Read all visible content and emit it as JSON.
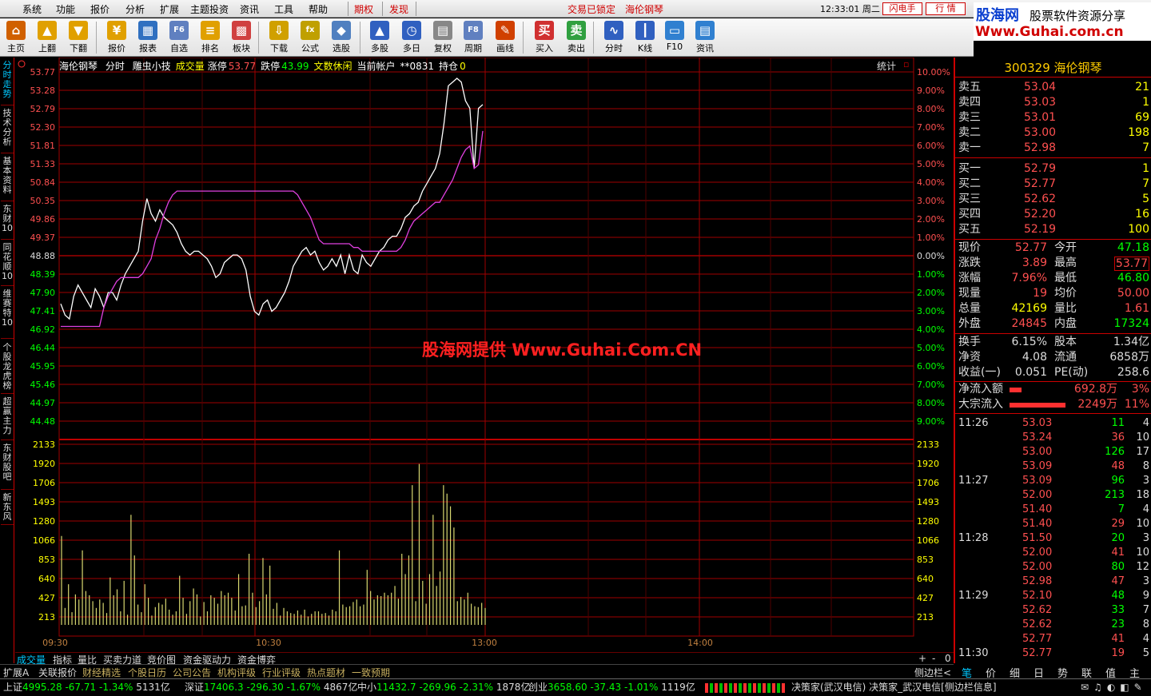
{
  "menu": {
    "items": [
      "系统",
      "功能",
      "报价",
      "分析",
      "扩展",
      "主题投资",
      "资讯",
      "工具",
      "帮助"
    ],
    "qiquan": "期权",
    "faxian": "发现",
    "center_status": "交易已锁定",
    "center_stock": "海伦钢琴",
    "clock": "12:33:01 周二",
    "btn_flash": "闪电手",
    "btn_quote": "行  情"
  },
  "logo": {
    "cn": "股海网",
    "slogan": "股票软件资源分享",
    "url": "Www.Guhai.com.cn"
  },
  "toolbar": [
    {
      "label": "主页",
      "icon": "home-icon",
      "color": "#d06000",
      "glyph": "⌂"
    },
    {
      "label": "上翻",
      "icon": "arrow-up-icon",
      "color": "#e0a000",
      "glyph": "▲"
    },
    {
      "label": "下翻",
      "icon": "arrow-down-icon",
      "color": "#e0a000",
      "glyph": "▼"
    },
    {
      "label": "报价",
      "icon": "yuan-icon",
      "color": "#e0a000",
      "glyph": "¥"
    },
    {
      "label": "报表",
      "icon": "report-icon",
      "color": "#3070c0",
      "glyph": "▦"
    },
    {
      "label": "自选",
      "icon": "f6-icon",
      "color": "#6080c0",
      "glyph": "F6"
    },
    {
      "label": "排名",
      "icon": "rank-icon",
      "color": "#e0a000",
      "glyph": "≡"
    },
    {
      "label": "板块",
      "icon": "sector-icon",
      "color": "#d04040",
      "glyph": "▩"
    },
    {
      "label": "下载",
      "icon": "download-icon",
      "color": "#d0a000",
      "glyph": "⇩"
    },
    {
      "label": "公式",
      "icon": "formula-icon",
      "color": "#c0a000",
      "glyph": "fx"
    },
    {
      "label": "选股",
      "icon": "pick-stock-icon",
      "color": "#5080c0",
      "glyph": "◆"
    },
    {
      "label": "多股",
      "icon": "multi-stock-icon",
      "color": "#3060c0",
      "glyph": "▲"
    },
    {
      "label": "多日",
      "icon": "multi-day-icon",
      "color": "#3060c0",
      "glyph": "◷"
    },
    {
      "label": "复权",
      "icon": "restore-right-icon",
      "color": "#888888",
      "glyph": "▤"
    },
    {
      "label": "周期",
      "icon": "f8-icon",
      "color": "#6080c0",
      "glyph": "F8"
    },
    {
      "label": "画线",
      "icon": "draw-line-icon",
      "color": "#d04000",
      "glyph": "✎"
    },
    {
      "label": "买入",
      "icon": "buy-icon",
      "color": "#d03030",
      "glyph": "买"
    },
    {
      "label": "卖出",
      "icon": "sell-icon",
      "color": "#30a040",
      "glyph": "卖"
    },
    {
      "label": "分时",
      "icon": "intraday-icon",
      "color": "#3060c0",
      "glyph": "∿"
    },
    {
      "label": "K线",
      "icon": "kline-icon",
      "color": "#3060c0",
      "glyph": "┃"
    },
    {
      "label": "F10",
      "icon": "f10-icon",
      "color": "#3080d0",
      "glyph": "▭"
    },
    {
      "label": "资讯",
      "icon": "news-icon",
      "color": "#3080d0",
      "glyph": "▤"
    }
  ],
  "side_tabs": [
    "分时走势",
    "技术分析",
    "基本资料",
    "东财10",
    "同花顺10",
    "维赛特10",
    "个股龙虎榜",
    "超赢主力",
    "东财股吧",
    "新东风"
  ],
  "chart_header": {
    "name": "海伦钢琴",
    "mode": "分时",
    "tool": "雕虫小技",
    "vol_label": "成交量",
    "limit_up_label": "涨停",
    "limit_up": "53.77",
    "limit_down_label": "跌停",
    "limit_down": "43.99",
    "event": "文数休闲",
    "account": "当前帐户",
    "account_no": "**0831",
    "position_label": "持仓",
    "position": "0",
    "stats": "统计",
    "watermark": "股海网提供 Www.Guhai.Com.CN"
  },
  "chart_data": {
    "type": "line",
    "prev_close": 48.88,
    "price_ticks": [
      "53.77",
      "53.28",
      "52.79",
      "52.30",
      "51.81",
      "51.33",
      "50.84",
      "50.35",
      "49.86",
      "49.37",
      "48.88",
      "48.39",
      "47.90",
      "47.41",
      "46.92",
      "46.44",
      "45.95",
      "45.46",
      "44.97",
      "44.48"
    ],
    "pct_ticks": [
      "10.00%",
      "9.00%",
      "8.00%",
      "7.00%",
      "6.00%",
      "5.00%",
      "4.00%",
      "3.00%",
      "2.00%",
      "1.00%",
      "0.00%",
      "1.00%",
      "2.00%",
      "3.00%",
      "4.00%",
      "5.00%",
      "6.00%",
      "7.00%",
      "8.00%",
      "9.00%"
    ],
    "vol_ticks": [
      "2133",
      "1920",
      "1706",
      "1493",
      "1280",
      "1066",
      "853",
      "640",
      "427",
      "213"
    ],
    "time_ticks": [
      "09:30",
      "10:30",
      "13:00",
      "14:00"
    ],
    "series": [
      {
        "color": "#ffffff",
        "values": [
          47.6,
          47.3,
          47.2,
          47.8,
          48.1,
          47.9,
          47.7,
          47.5,
          48.0,
          47.8,
          47.5,
          47.9,
          47.9,
          47.7,
          48.1,
          48.4,
          48.6,
          48.8,
          49.0,
          49.8,
          50.4,
          50.0,
          49.8,
          50.1,
          49.9,
          49.8,
          49.7,
          49.5,
          49.2,
          49.0,
          48.9,
          49.0,
          49.0,
          48.9,
          48.8,
          48.6,
          48.3,
          48.4,
          48.7,
          48.8,
          48.9,
          48.9,
          48.8,
          48.5,
          47.8,
          47.4,
          47.3,
          47.6,
          47.7,
          47.4,
          47.5,
          47.7,
          47.9,
          48.2,
          48.6,
          48.8,
          49.0,
          49.1,
          48.9,
          49.0,
          48.7,
          48.5,
          48.6,
          48.8,
          48.6,
          48.9,
          48.4,
          48.9,
          48.5,
          48.4,
          48.9,
          48.7,
          48.6,
          48.8,
          49.0,
          49.1,
          49.3,
          49.4,
          49.4,
          49.6,
          49.9,
          50.0,
          50.2,
          50.3,
          50.6,
          50.8,
          51.0,
          51.2,
          51.6,
          52.4,
          53.4,
          53.5,
          53.6,
          53.5,
          53.0,
          52.8,
          51.2,
          52.8,
          52.9
        ]
      },
      {
        "color": "#e040e0",
        "values": [
          47.0,
          47.0,
          47.0,
          47.0,
          47.0,
          47.0,
          47.0,
          47.0,
          47.0,
          47.0,
          47.5,
          47.8,
          48.0,
          48.2,
          48.3,
          48.3,
          48.3,
          48.3,
          48.3,
          48.4,
          48.6,
          48.8,
          49.3,
          49.6,
          50.0,
          50.3,
          50.5,
          50.6,
          50.6,
          50.6,
          50.6,
          50.6,
          50.6,
          50.6,
          50.6,
          50.6,
          50.6,
          50.6,
          50.6,
          50.6,
          50.6,
          50.6,
          50.6,
          50.6,
          50.6,
          50.6,
          50.6,
          50.6,
          50.6,
          50.6,
          50.6,
          50.6,
          50.6,
          50.6,
          50.6,
          50.5,
          50.3,
          50.1,
          49.9,
          49.6,
          49.3,
          49.2,
          49.2,
          49.2,
          49.2,
          49.2,
          49.2,
          49.2,
          49.1,
          49.1,
          49.0,
          49.0,
          49.0,
          49.0,
          49.0,
          49.0,
          49.0,
          49.0,
          49.0,
          49.1,
          49.3,
          49.6,
          49.8,
          49.9,
          50.0,
          50.1,
          50.2,
          50.3,
          50.3,
          50.5,
          50.7,
          50.9,
          51.2,
          51.5,
          51.7,
          51.8,
          51.2,
          51.3,
          52.2
        ]
      }
    ],
    "volumes": [
      1050,
      200,
      480,
      150,
      360,
      300,
      880,
      400,
      350,
      280,
      200,
      300,
      260,
      140,
      560,
      350,
      420,
      160,
      520,
      120,
      1300,
      820,
      240,
      150,
      480,
      320,
      110,
      210,
      260,
      240,
      310,
      180,
      120,
      160,
      580,
      320,
      130,
      280,
      430,
      360,
      100,
      270,
      160,
      350,
      320,
      250,
      400,
      350,
      380,
      320,
      170,
      600,
      220,
      230,
      840,
      380,
      210,
      280,
      790,
      360,
      700,
      190,
      260,
      110,
      200,
      160,
      140,
      130,
      170,
      120,
      180,
      100,
      130,
      160,
      160,
      130,
      140,
      110,
      180,
      160,
      880,
      240,
      210,
      220,
      270,
      300,
      220,
      240,
      650,
      400,
      300,
      350,
      340,
      380,
      350,
      380,
      460,
      310,
      840,
      600,
      820,
      1650,
      280,
      1900,
      520,
      250,
      600,
      1300,
      460,
      630,
      1650,
      1550,
      1400,
      1150,
      280,
      330,
      300,
      380,
      250,
      220,
      210,
      260,
      200
    ]
  },
  "right_panel": {
    "title": "300329 海伦钢琴",
    "ask": [
      {
        "label": "卖五",
        "price": "53.04",
        "vol": "21"
      },
      {
        "label": "卖四",
        "price": "53.03",
        "vol": "1"
      },
      {
        "label": "卖三",
        "price": "53.01",
        "vol": "69"
      },
      {
        "label": "卖二",
        "price": "53.00",
        "vol": "198"
      },
      {
        "label": "卖一",
        "price": "52.98",
        "vol": "7"
      }
    ],
    "bid": [
      {
        "label": "买一",
        "price": "52.79",
        "vol": "1"
      },
      {
        "label": "买二",
        "price": "52.77",
        "vol": "7"
      },
      {
        "label": "买三",
        "price": "52.62",
        "vol": "5"
      },
      {
        "label": "买四",
        "price": "52.20",
        "vol": "16"
      },
      {
        "label": "买五",
        "price": "52.19",
        "vol": "100"
      }
    ],
    "stats": [
      {
        "l1": "现价",
        "v1": "52.77",
        "l2": "今开",
        "v2": "47.18",
        "c1": "#ff5050",
        "c2": "#00ff00"
      },
      {
        "l1": "涨跌",
        "v1": "3.89",
        "l2": "最高",
        "v2": "53.77",
        "c1": "#ff5050",
        "c2": "#ff5050"
      },
      {
        "l1": "涨幅",
        "v1": "7.96%",
        "l2": "最低",
        "v2": "46.80",
        "c1": "#ff5050",
        "c2": "#00ff00"
      },
      {
        "l1": "现量",
        "v1": "19",
        "l2": "均价",
        "v2": "50.00",
        "c1": "#ff5050",
        "c2": "#ff5050"
      },
      {
        "l1": "总量",
        "v1": "42169",
        "l2": "量比",
        "v2": "1.61",
        "c1": "#ffff00",
        "c2": "#ff5050"
      },
      {
        "l1": "外盘",
        "v1": "24845",
        "l2": "内盘",
        "v2": "17324",
        "c1": "#ff5050",
        "c2": "#00ff00"
      }
    ],
    "stats2": [
      {
        "l1": "换手",
        "v1": "6.15%",
        "l2": "股本",
        "v2": "1.34亿"
      },
      {
        "l1": "净资",
        "v1": "4.08",
        "l2": "流通",
        "v2": "6858万"
      },
      {
        "l1": "收益(一)",
        "v1": "0.051",
        "l2": "PE(动)",
        "v2": "258.6"
      }
    ],
    "flows": [
      {
        "label": "净流入额",
        "amount": "692.8万",
        "pct": "3%",
        "bar": 0.22
      },
      {
        "label": "大宗流入",
        "amount": "2249万",
        "pct": "11%",
        "bar": 1.0
      }
    ],
    "ticks": [
      {
        "time": "11:26",
        "price": "53.03",
        "vol": "11",
        "n": "4",
        "pc": "#ff5050",
        "vc": "#00ff00"
      },
      {
        "time": "",
        "price": "53.24",
        "vol": "36",
        "n": "10",
        "pc": "#ff5050",
        "vc": "#ff5050"
      },
      {
        "time": "",
        "price": "53.00",
        "vol": "126",
        "n": "17",
        "pc": "#ff5050",
        "vc": "#00ff00"
      },
      {
        "time": "",
        "price": "53.09",
        "vol": "48",
        "n": "8",
        "pc": "#ff5050",
        "vc": "#ff5050"
      },
      {
        "time": "11:27",
        "price": "53.09",
        "vol": "96",
        "n": "3",
        "pc": "#ff5050",
        "vc": "#00ff00"
      },
      {
        "time": "",
        "price": "52.00",
        "vol": "213",
        "n": "18",
        "pc": "#ff5050",
        "vc": "#00ff00"
      },
      {
        "time": "",
        "price": "51.40",
        "vol": "7",
        "n": "4",
        "pc": "#ff5050",
        "vc": "#00ff00"
      },
      {
        "time": "",
        "price": "51.40",
        "vol": "29",
        "n": "10",
        "pc": "#ff5050",
        "vc": "#ff5050"
      },
      {
        "time": "11:28",
        "price": "51.50",
        "vol": "20",
        "n": "3",
        "pc": "#ff5050",
        "vc": "#00ff00"
      },
      {
        "time": "",
        "price": "52.00",
        "vol": "41",
        "n": "10",
        "pc": "#ff5050",
        "vc": "#ff5050"
      },
      {
        "time": "",
        "price": "52.00",
        "vol": "80",
        "n": "12",
        "pc": "#ff5050",
        "vc": "#00ff00"
      },
      {
        "time": "",
        "price": "52.98",
        "vol": "47",
        "n": "3",
        "pc": "#ff5050",
        "vc": "#ff5050"
      },
      {
        "time": "11:29",
        "price": "52.10",
        "vol": "48",
        "n": "9",
        "pc": "#ff5050",
        "vc": "#00ff00"
      },
      {
        "time": "",
        "price": "52.62",
        "vol": "33",
        "n": "7",
        "pc": "#ff5050",
        "vc": "#00ff00"
      },
      {
        "time": "",
        "price": "52.62",
        "vol": "23",
        "n": "8",
        "pc": "#ff5050",
        "vc": "#00ff00"
      },
      {
        "time": "",
        "price": "52.77",
        "vol": "41",
        "n": "4",
        "pc": "#ff5050",
        "vc": "#ff5050"
      },
      {
        "time": "11:30",
        "price": "52.77",
        "vol": "19",
        "n": "5",
        "pc": "#ff5050",
        "vc": "#ff5050"
      }
    ],
    "tabs": [
      "笔",
      "价",
      "细",
      "日",
      "势",
      "联",
      "值",
      "主"
    ]
  },
  "bottom_tabs": [
    "成交量",
    "指标",
    "量比",
    "买卖力道",
    "竞价图",
    "资金驱动力",
    "资金博弈"
  ],
  "bottom_right": [
    "+",
    "-",
    "0"
  ],
  "func_tabs": [
    "扩展A",
    "关联报价",
    "财经精选",
    "个股日历",
    "公司公告",
    "机构评级",
    "行业评级",
    "热点题材",
    "一致预期"
  ],
  "func_right": "侧边栏<",
  "status": {
    "sh_label": "上证",
    "sh_val": "4995.28",
    "sh_chg": "-67.71",
    "sh_pct": "-1.34%",
    "sh_amt": "5131亿",
    "sz_label": "深证",
    "sz_val": "17406.3",
    "sz_chg": "-296.30",
    "sz_pct": "-1.67%",
    "sz_amt": "4867亿",
    "zx_label": "中小",
    "zx_val": "11432.7",
    "zx_chg": "-269.96",
    "zx_pct": "-2.31%",
    "zx_amt": "1878亿",
    "cy_label": "创业",
    "cy_val": "3658.60",
    "cy_chg": "-37.43",
    "cy_pct": "-1.01%",
    "cy_amt": "1119亿",
    "ticker": "决策家(武汉电信)  决策家_武汉电信[侧边栏信息]"
  }
}
